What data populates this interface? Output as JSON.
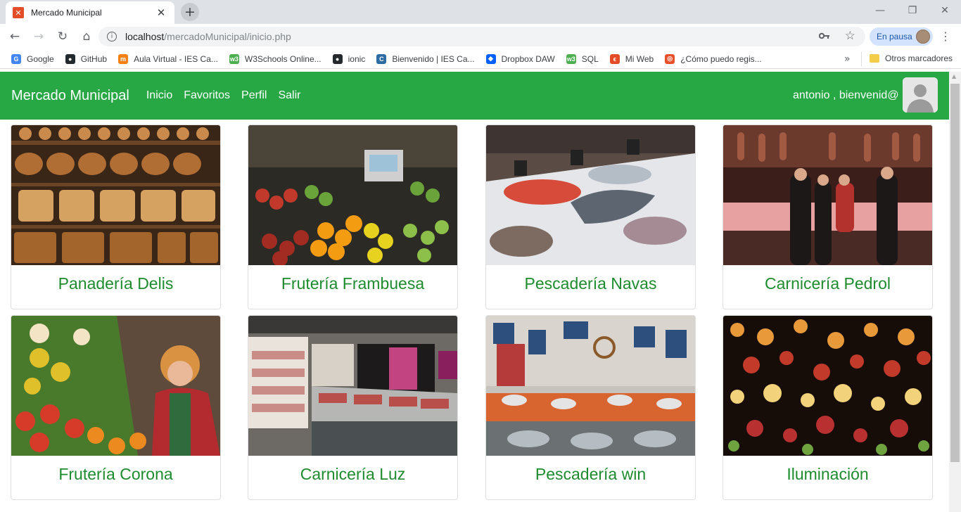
{
  "browser": {
    "tab_title": "Mercado Municipal",
    "tab_favicon": "xampp-icon",
    "url_host": "localhost",
    "url_path": "/mercadoMunicipal/inicio.php",
    "profile_label": "En pausa",
    "bookmarks": [
      {
        "label": "Google",
        "icon": "google-icon",
        "color": "#4285f4"
      },
      {
        "label": "GitHub",
        "icon": "github-icon",
        "color": "#24292e"
      },
      {
        "label": "Aula Virtual - IES Ca...",
        "icon": "moodle-icon",
        "color": "#f98012"
      },
      {
        "label": "W3Schools Online...",
        "icon": "w3schools-icon",
        "color": "#4caf50"
      },
      {
        "label": "ionic",
        "icon": "github-icon",
        "color": "#24292e"
      },
      {
        "label": "Bienvenido | IES Ca...",
        "icon": "school-icon",
        "color": "#2b6ca3"
      },
      {
        "label": "Dropbox DAW",
        "icon": "dropbox-icon",
        "color": "#0061ff"
      },
      {
        "label": "SQL",
        "icon": "w3schools-icon",
        "color": "#4caf50"
      },
      {
        "label": "Mi Web",
        "icon": "web-icon",
        "color": "#e34c26"
      },
      {
        "label": "¿Cómo puedo regis...",
        "icon": "question-icon",
        "color": "#e8512c"
      }
    ],
    "bookmarks_more": "»",
    "other_bookmarks": "Otros marcadores"
  },
  "site": {
    "brand": "Mercado Municipal",
    "nav": [
      "Inicio",
      "Favoritos",
      "Perfil",
      "Salir"
    ],
    "greeting": "antonio , bienvenid@",
    "accent_color": "#28a745"
  },
  "shops": [
    {
      "name": "Panadería Delis",
      "image": "bakery-shelves-photo"
    },
    {
      "name": "Frutería Frambuesa",
      "image": "fruit-stall-photo"
    },
    {
      "name": "Pescadería Navas",
      "image": "fish-counter-photo"
    },
    {
      "name": "Carnicería Pedrol",
      "image": "butcher-shop-photo"
    },
    {
      "name": "Frutería Corona",
      "image": "fruit-vendor-photo"
    },
    {
      "name": "Carnicería Luz",
      "image": "meat-counter-photo"
    },
    {
      "name": "Pescadería win",
      "image": "seafood-market-photo"
    },
    {
      "name": "Iluminación",
      "image": "lamps-shop-photo"
    }
  ]
}
